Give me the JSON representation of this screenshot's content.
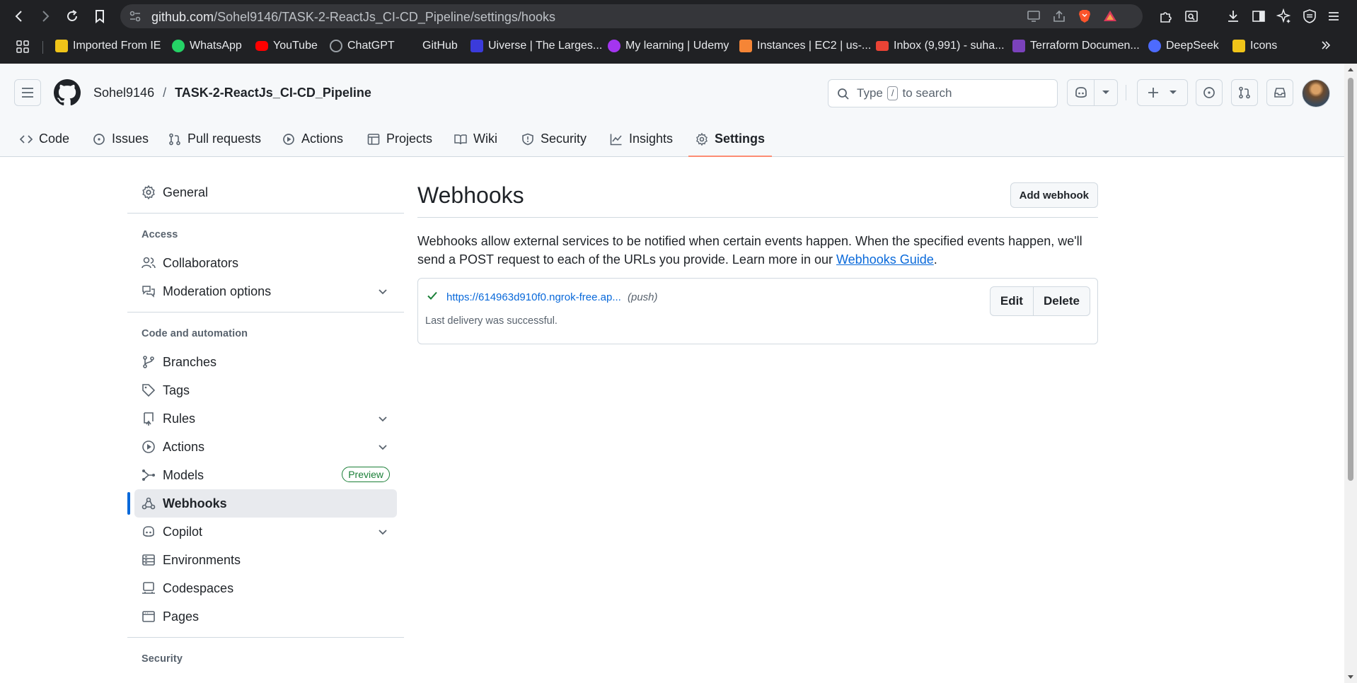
{
  "browser": {
    "url_host": "github.com",
    "url_path": "/Sohel9146/TASK-2-ReactJs_CI-CD_Pipeline/settings/hooks",
    "bookmarks": [
      {
        "label": "Imported From IE",
        "color": "#f0c419"
      },
      {
        "label": "WhatsApp",
        "color": "#25d366"
      },
      {
        "label": "YouTube",
        "color": "#ff0000"
      },
      {
        "label": "ChatGPT",
        "color": "#202124"
      },
      {
        "label": "GitHub",
        "color": "#202124"
      },
      {
        "label": "Uiverse | The Larges...",
        "color": "#3b3bdb"
      },
      {
        "label": "My learning | Udemy",
        "color": "#a435f0"
      },
      {
        "label": "Instances | EC2 | us-...",
        "color": "#f58536"
      },
      {
        "label": "Inbox (9,991) - suha...",
        "color": "#ea4335"
      },
      {
        "label": "Terraform Documen...",
        "color": "#7b42bc"
      },
      {
        "label": "DeepSeek",
        "color": "#4d6bfe"
      },
      {
        "label": "Icons",
        "color": "#f0c419"
      }
    ]
  },
  "header": {
    "owner": "Sohel9146",
    "separator": "/",
    "repo": "TASK-2-ReactJs_CI-CD_Pipeline",
    "search_pre": "Type",
    "search_key": "/",
    "search_post": "to search"
  },
  "tabs": [
    {
      "label": "Code",
      "icon": "code-icon"
    },
    {
      "label": "Issues",
      "icon": "issue-icon"
    },
    {
      "label": "Pull requests",
      "icon": "pull-request-icon"
    },
    {
      "label": "Actions",
      "icon": "play-icon"
    },
    {
      "label": "Projects",
      "icon": "table-icon"
    },
    {
      "label": "Wiki",
      "icon": "book-icon"
    },
    {
      "label": "Security",
      "icon": "shield-icon"
    },
    {
      "label": "Insights",
      "icon": "graph-icon"
    },
    {
      "label": "Settings",
      "icon": "gear-icon"
    }
  ],
  "sidebar": {
    "general": "General",
    "access_heading": "Access",
    "collaborators": "Collaborators",
    "moderation": "Moderation options",
    "code_heading": "Code and automation",
    "branches": "Branches",
    "tags": "Tags",
    "rules": "Rules",
    "actions": "Actions",
    "models": "Models",
    "models_badge": "Preview",
    "webhooks": "Webhooks",
    "copilot": "Copilot",
    "environments": "Environments",
    "codespaces": "Codespaces",
    "pages": "Pages",
    "security_heading": "Security"
  },
  "main": {
    "title": "Webhooks",
    "add_button": "Add webhook",
    "description": "Webhooks allow external services to be notified when certain events happen. When the specified events happen, we'll send a POST request to each of the URLs you provide. Learn more in our ",
    "guide_link": "Webhooks Guide",
    "period": ".",
    "hook": {
      "url": "https://614963d910f0.ngrok-free.ap...",
      "events": "(push)",
      "status": "Last delivery was successful.",
      "edit": "Edit",
      "delete": "Delete"
    }
  }
}
